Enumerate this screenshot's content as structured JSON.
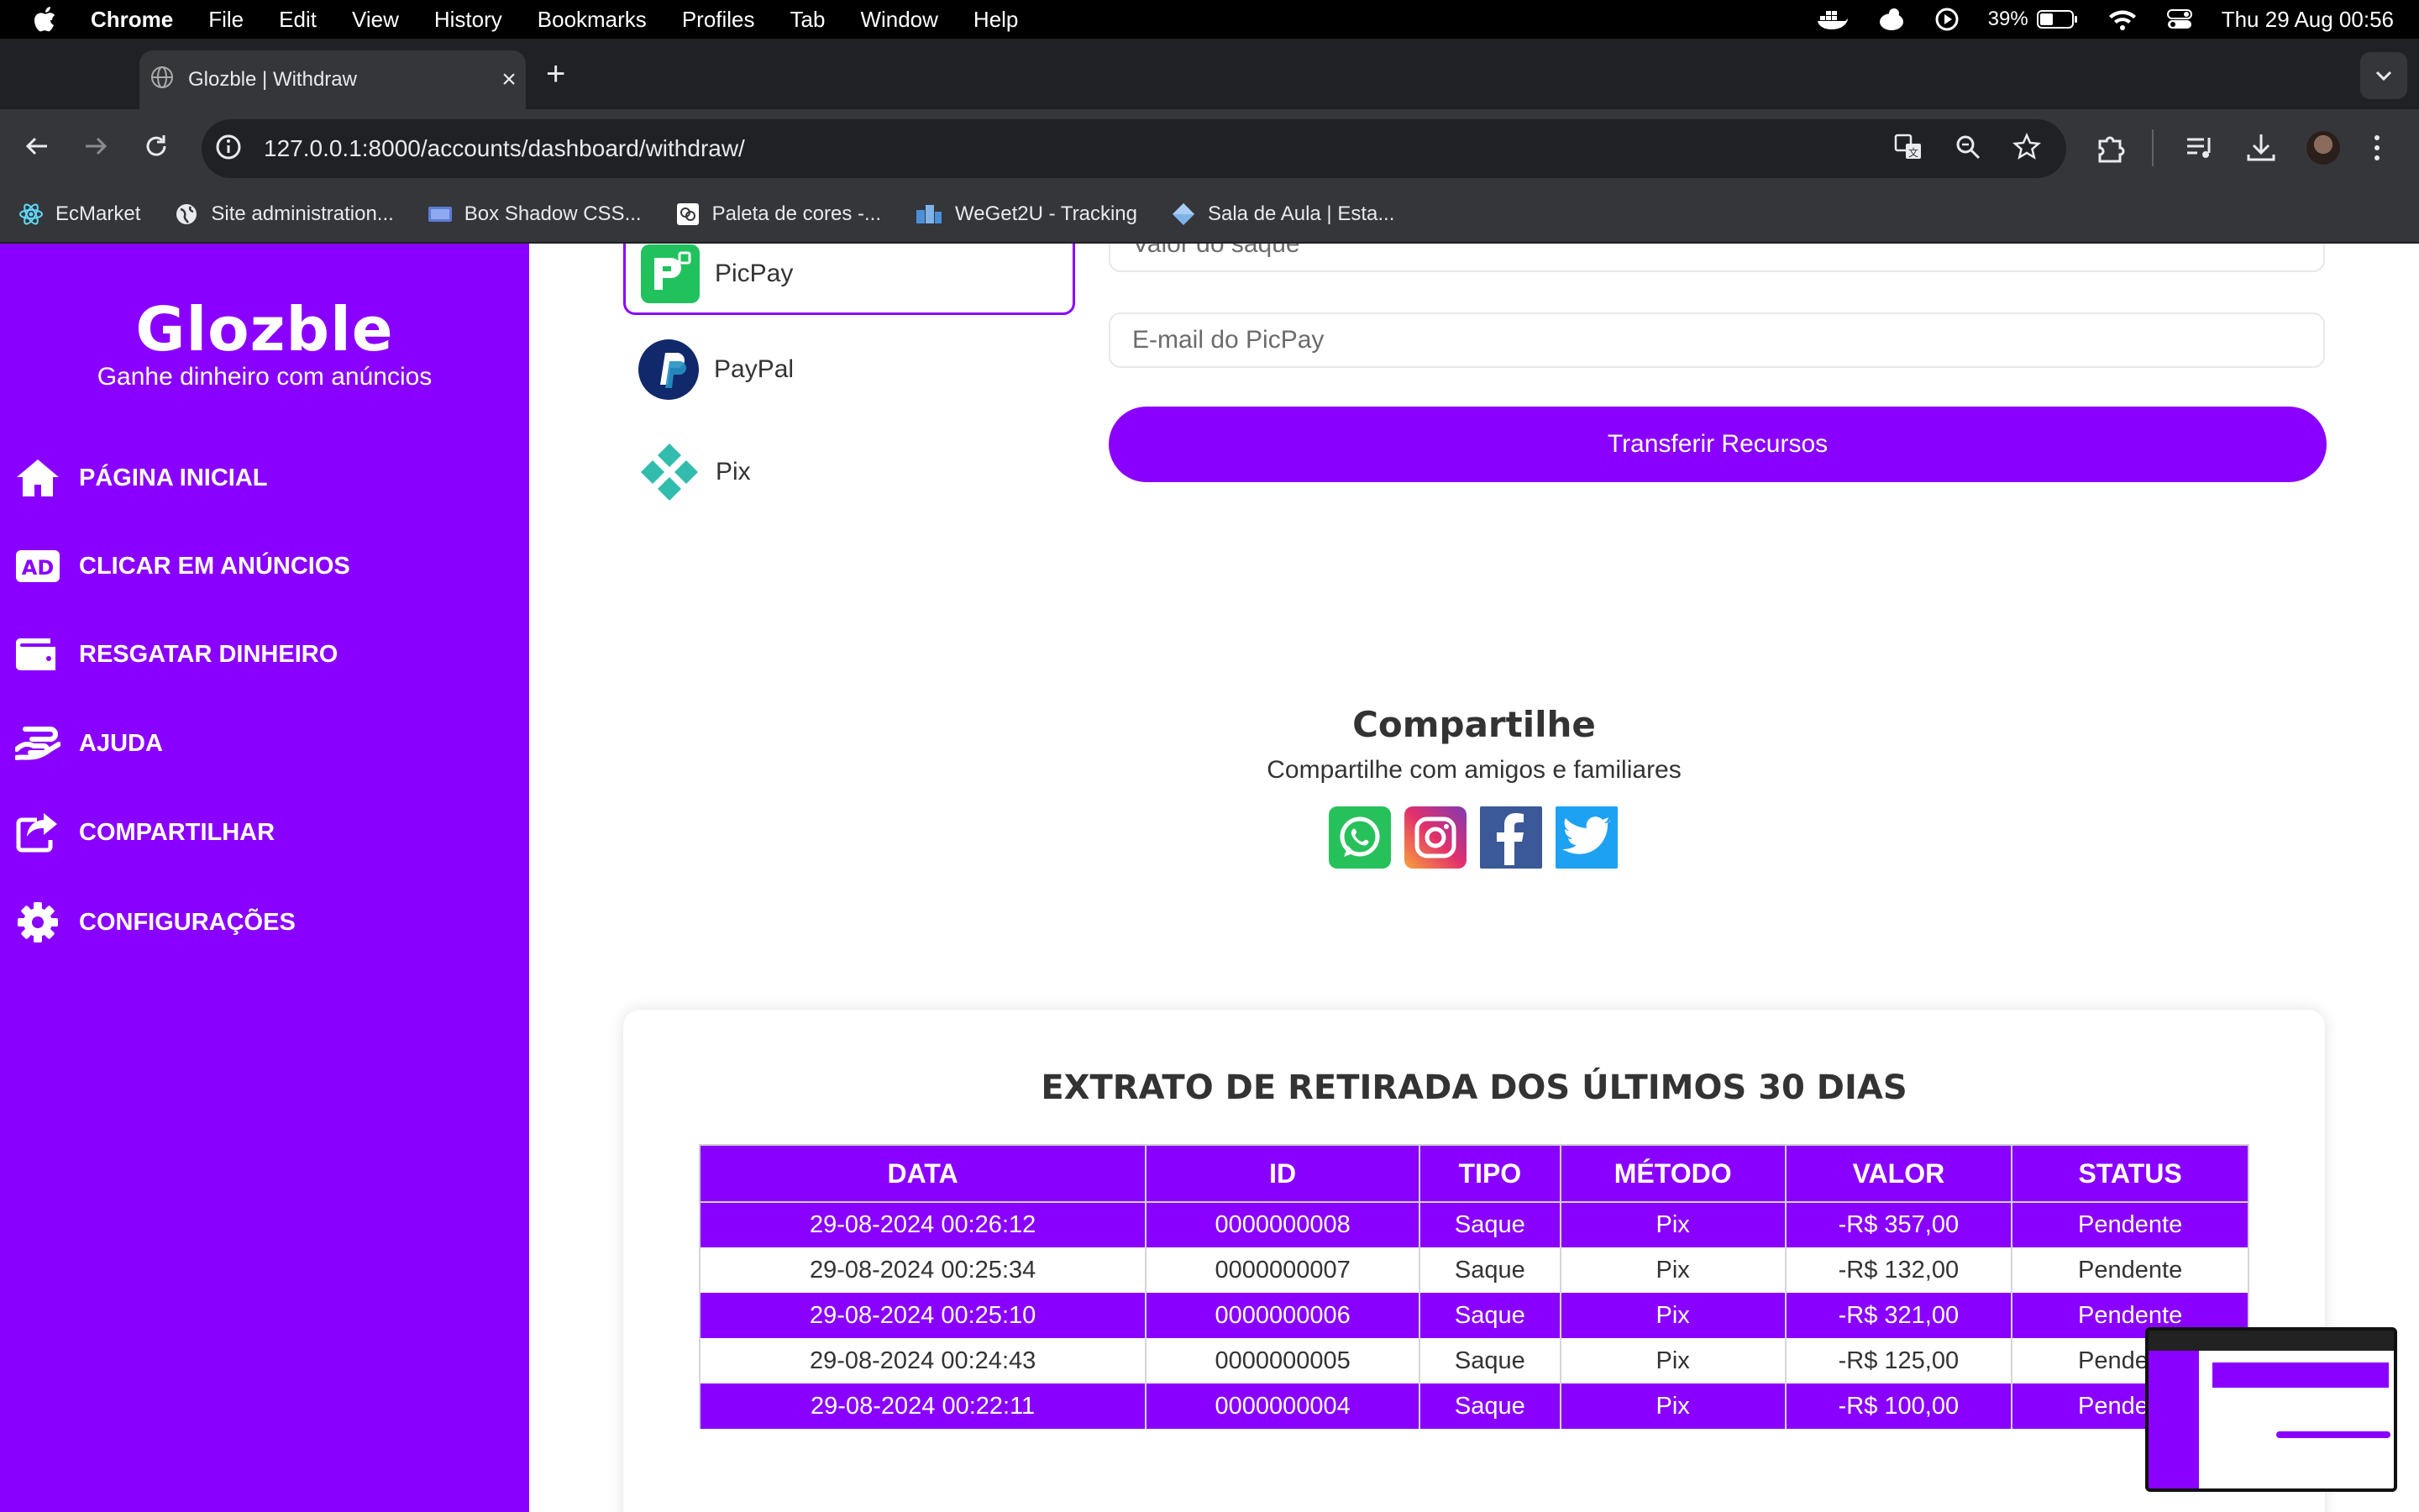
{
  "menubar": {
    "app": "Chrome",
    "items": [
      "File",
      "Edit",
      "View",
      "History",
      "Bookmarks",
      "Profiles",
      "Tab",
      "Window",
      "Help"
    ],
    "battery": "39%",
    "clock": "Thu 29 Aug  00:56"
  },
  "browser": {
    "tab_title": "Glozble | Withdraw",
    "url": "127.0.0.1:8000/accounts/dashboard/withdraw/",
    "bookmarks": [
      "EcMarket",
      "Site administration...",
      "Box Shadow CSS...",
      "Paleta de cores -...",
      "WeGet2U - Tracking",
      "Sala de Aula | Esta..."
    ]
  },
  "sidebar": {
    "brand": "Glozble",
    "tagline": "Ganhe dinheiro com anúncios",
    "items": [
      {
        "label": "PÁGINA INICIAL",
        "icon": "home-icon"
      },
      {
        "label": "CLICAR EM ANÚNCIOS",
        "icon": "ad-icon"
      },
      {
        "label": "RESGATAR DINHEIRO",
        "icon": "wallet-icon"
      },
      {
        "label": "AJUDA",
        "icon": "hand-money-icon"
      },
      {
        "label": "COMPARTILHAR",
        "icon": "share-icon"
      },
      {
        "label": "CONFIGURAÇÕES",
        "icon": "gear-icon"
      }
    ]
  },
  "withdraw": {
    "methods": [
      {
        "label": "PicPay",
        "icon": "picpay-icon",
        "active": true
      },
      {
        "label": "PayPal",
        "icon": "paypal-icon",
        "active": false
      },
      {
        "label": "Pix",
        "icon": "pix-icon",
        "active": false
      }
    ],
    "amount_placeholder": "Valor do saque",
    "email_placeholder": "E-mail do PicPay",
    "submit_label": "Transferir Recursos"
  },
  "share": {
    "title": "Compartilhe",
    "subtitle": "Compartilhe com amigos e familiares",
    "networks": [
      "whatsapp-icon",
      "instagram-icon",
      "facebook-icon",
      "twitter-icon"
    ]
  },
  "statement": {
    "title": "EXTRATO DE RETIRADA DOS ÚLTIMOS 30 DIAS",
    "columns": [
      "DATA",
      "ID",
      "TIPO",
      "MÉTODO",
      "VALOR",
      "STATUS"
    ],
    "rows": [
      [
        "29-08-2024 00:26:12",
        "0000000008",
        "Saque",
        "Pix",
        "-R$ 357,00",
        "Pendente"
      ],
      [
        "29-08-2024 00:25:34",
        "0000000007",
        "Saque",
        "Pix",
        "-R$ 132,00",
        "Pendente"
      ],
      [
        "29-08-2024 00:25:10",
        "0000000006",
        "Saque",
        "Pix",
        "-R$ 321,00",
        "Pendente"
      ],
      [
        "29-08-2024 00:24:43",
        "0000000005",
        "Saque",
        "Pix",
        "-R$ 125,00",
        "Pendente"
      ],
      [
        "29-08-2024 00:22:11",
        "0000000004",
        "Saque",
        "Pix",
        "-R$ 100,00",
        "Pendente"
      ]
    ]
  },
  "colors": {
    "accent": "#8a00ff",
    "chrome_dark": "#202124",
    "chrome_toolbar": "#35363a"
  }
}
